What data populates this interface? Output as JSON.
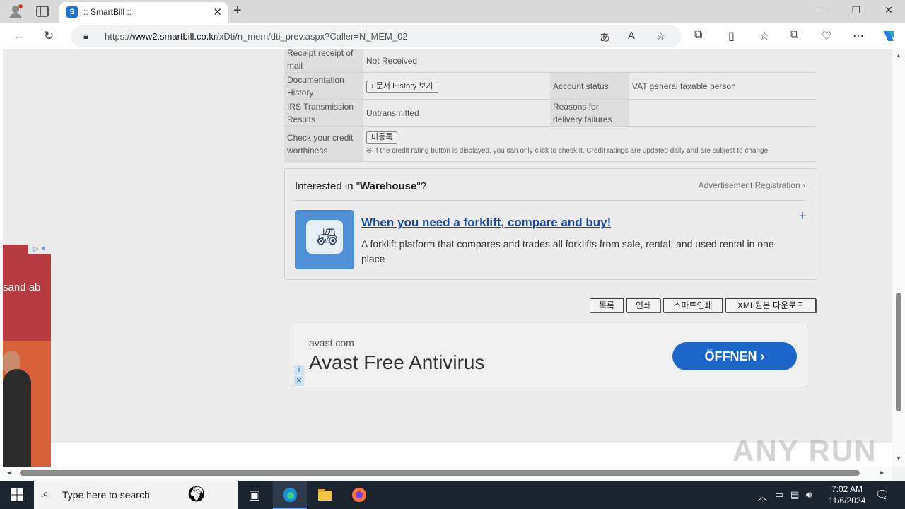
{
  "browser": {
    "tab_title": ":: SmartBill ::",
    "tab_favicon": "S",
    "url_prefix": "https://",
    "url_host": "www2.smartbill.co.kr",
    "url_path": "/xDti/n_mem/dti_prev.aspx?Caller=N_MEM_02"
  },
  "info_table": {
    "rows": [
      {
        "label": "Receipt receipt of mail",
        "value": "Not Received"
      },
      {
        "label": "Documentation History",
        "button": "› 문서 History 보기",
        "label2": "Account status",
        "value2": "VAT general taxable person"
      },
      {
        "label": "IRS Transmission Results",
        "value": "Untransmitted",
        "label2": "Reasons for delivery failures",
        "value2": ""
      },
      {
        "label": "Check your credit worthiness",
        "button": "미등록",
        "note": "※ If the credit rating button is displayed, you can only click to check it. Credit ratings are updated daily and are subject to change."
      }
    ]
  },
  "ad_box": {
    "heading_pre": "Interested in \"",
    "heading_keyword": "Warehouse",
    "heading_post": "\"?",
    "registration": "Advertisement Registration ›",
    "title": "When you need a forklift, compare and buy!",
    "description": "A forklift platform that compares and trades all forklifts from sale, rental, and used rental in one place",
    "plus": "+"
  },
  "buttons": {
    "list": "목록",
    "print": "인쇄",
    "smart_print": "스마트인쇄",
    "xml_download": "XML원본 다운로드"
  },
  "avast": {
    "domain": "avast.com",
    "title": "Avast Free Antivirus",
    "cta": "ÖFFNEN ›"
  },
  "side_ad": {
    "text": "sand ab"
  },
  "watermark": "ANY RUN",
  "taskbar": {
    "search_placeholder": "Type here to search",
    "time": "7:02 AM",
    "date": "11/6/2024"
  }
}
